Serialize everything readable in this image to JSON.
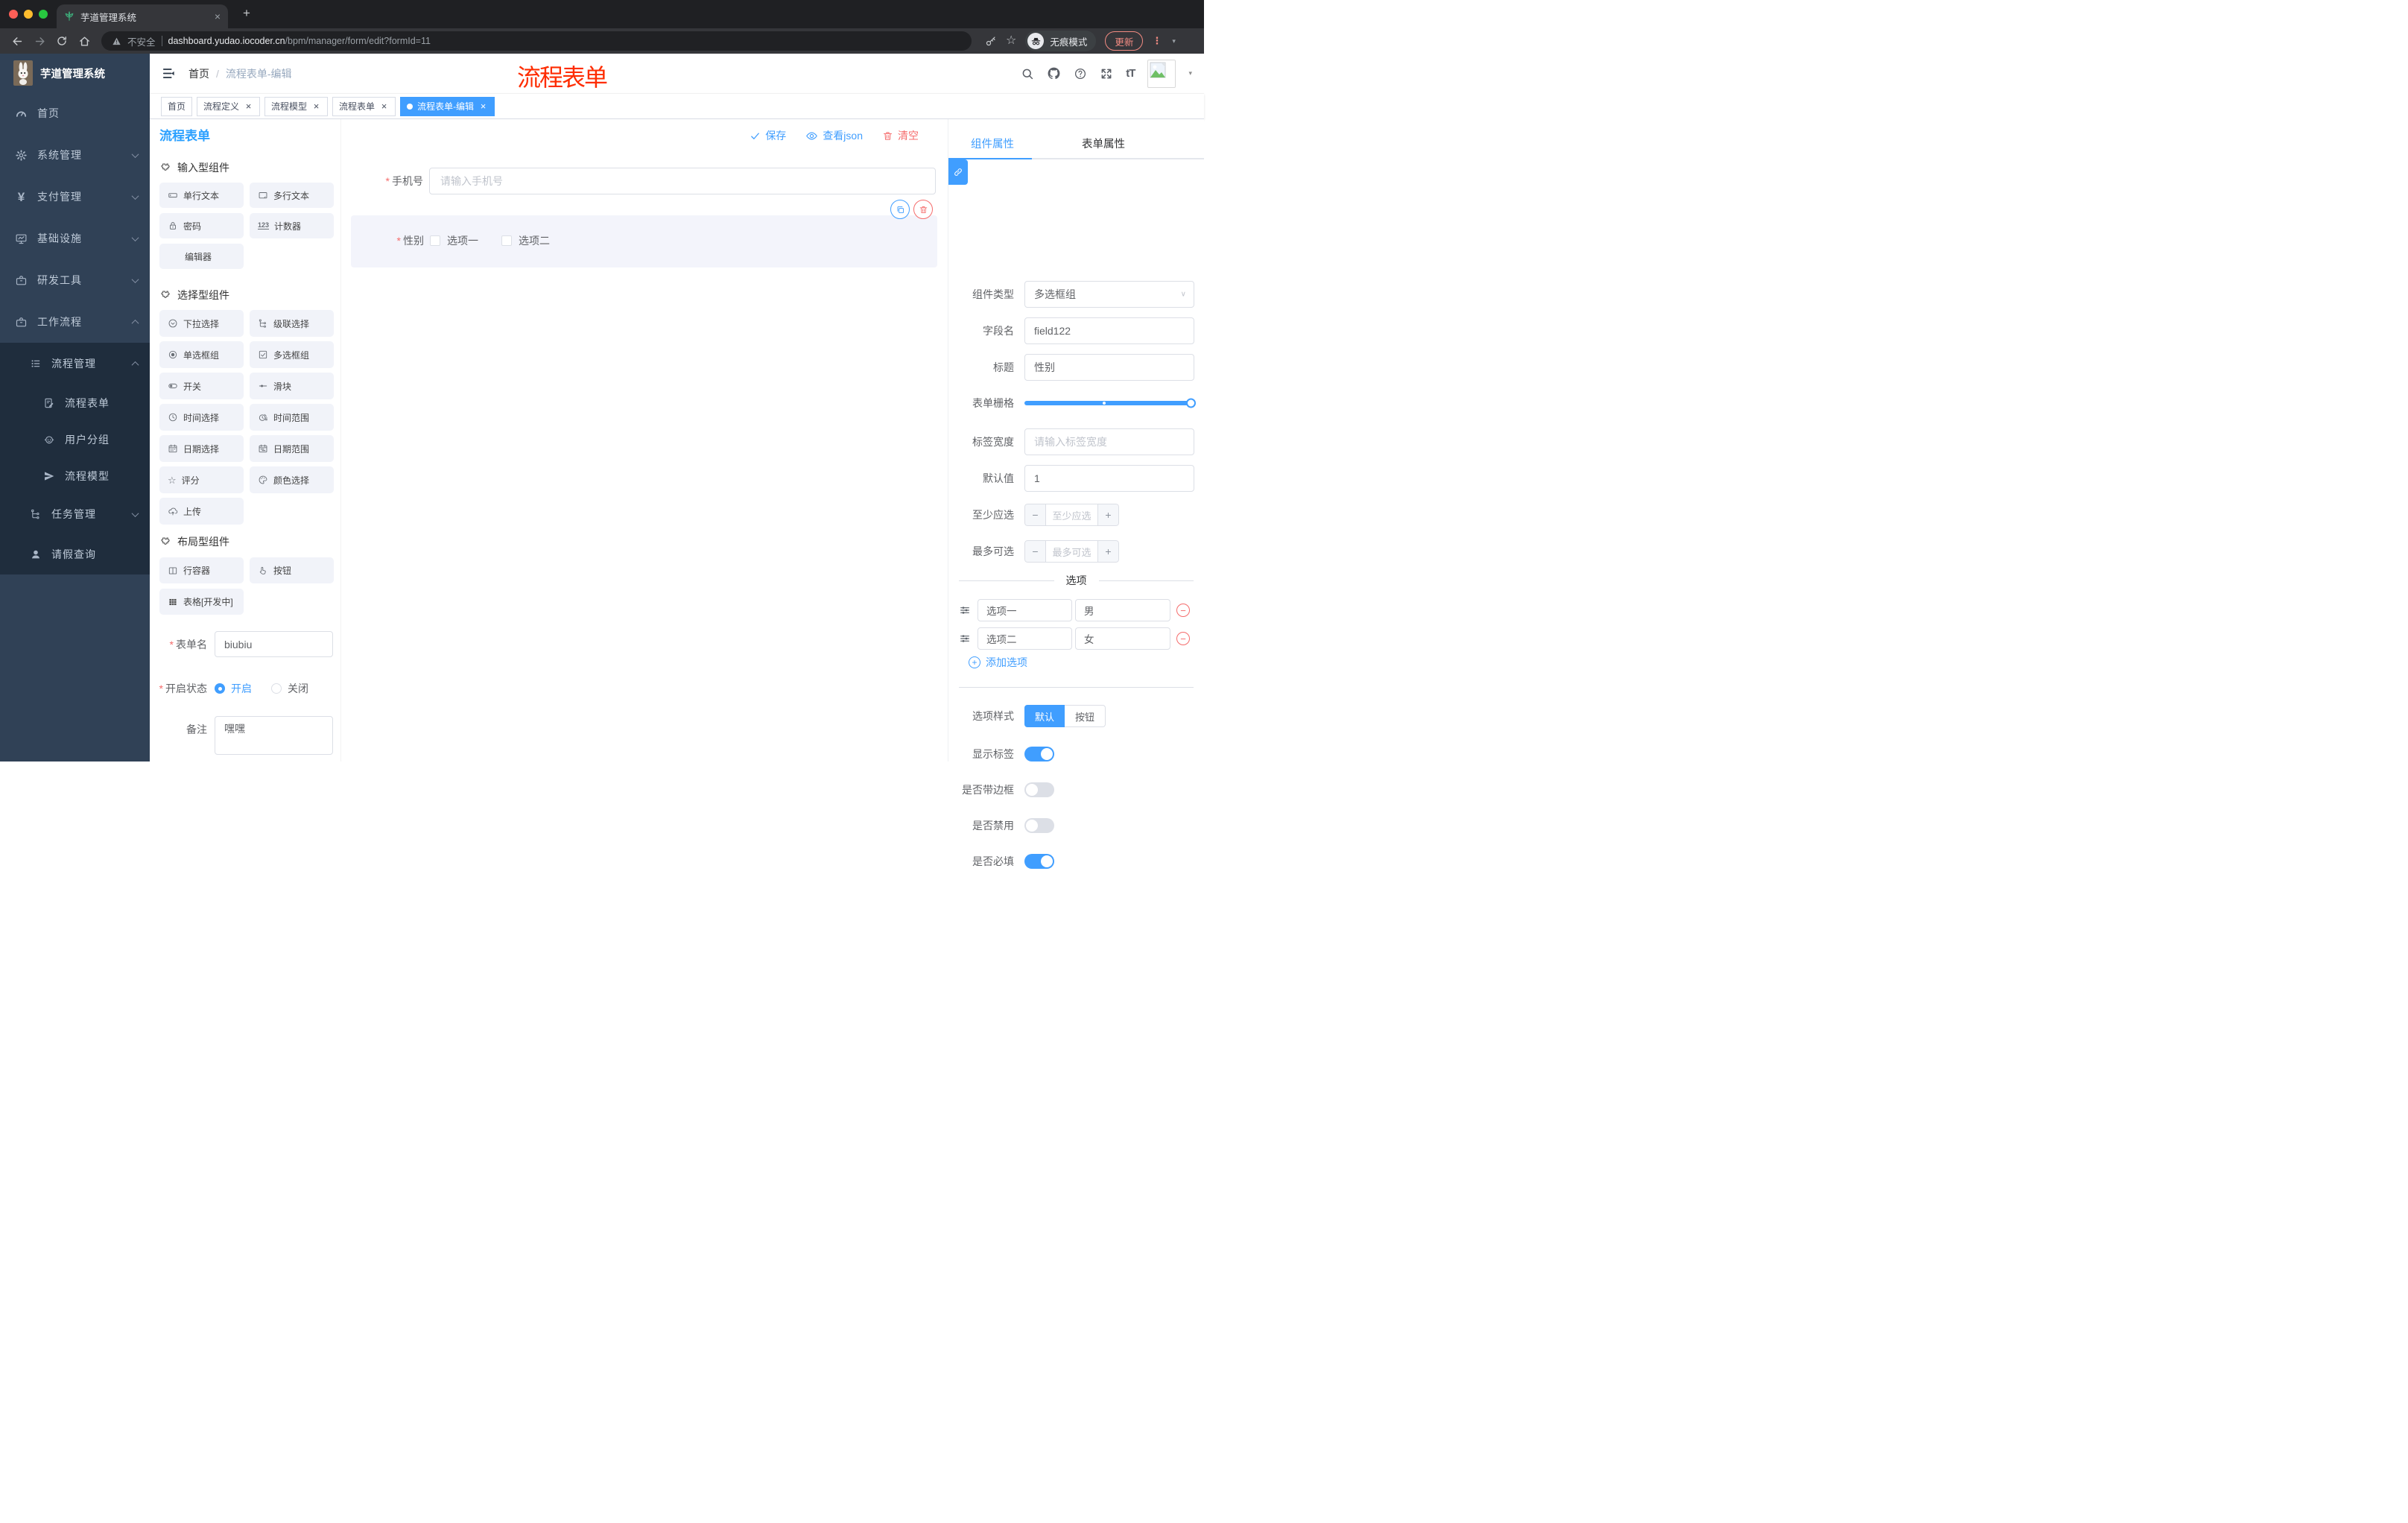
{
  "glyphs": {
    "close": "×",
    "plus": "+",
    "minus": "−",
    "caret_down": "▾",
    "slash": "/",
    "yen": "¥",
    "counter": "123",
    "star": "☆",
    "font_size": "tT",
    "asterisk": "*",
    "dots_v": "⋮"
  },
  "browser": {
    "tab_title": "芋道管理系统",
    "security_label": "不安全",
    "url_host": "dashboard.yudao.iocoder.cn",
    "url_path": "/bpm/manager/form/edit?formId=11",
    "incognito_label": "无痕模式",
    "update_label": "更新"
  },
  "sidebar": {
    "title": "芋道管理系统",
    "items": [
      {
        "label": "首页",
        "icon": "dashboard-icon"
      },
      {
        "label": "系统管理",
        "icon": "gear-icon",
        "chevron": "down"
      },
      {
        "label": "支付管理",
        "icon": "yen-icon",
        "chevron": "down"
      },
      {
        "label": "基础设施",
        "icon": "monitor-icon",
        "chevron": "down"
      },
      {
        "label": "研发工具",
        "icon": "toolbox-icon",
        "chevron": "down"
      },
      {
        "label": "工作流程",
        "icon": "briefcase-icon",
        "chevron": "up"
      },
      {
        "label": "流程管理",
        "icon": "flow-list-icon",
        "chevron": "up"
      },
      {
        "label": "流程表单",
        "icon": "doc-edit-icon"
      },
      {
        "label": "用户分组",
        "icon": "robot-icon"
      },
      {
        "label": "流程模型",
        "icon": "send-icon"
      },
      {
        "label": "任务管理",
        "icon": "tree-icon",
        "chevron": "down"
      },
      {
        "label": "请假查询",
        "icon": "user-icon"
      }
    ]
  },
  "header": {
    "breadcrumb_home": "首页",
    "breadcrumb_current": "流程表单-编辑"
  },
  "annotation": "流程表单",
  "tags": [
    {
      "label": "首页"
    },
    {
      "label": "流程定义"
    },
    {
      "label": "流程模型"
    },
    {
      "label": "流程表单"
    },
    {
      "label": "流程表单-编辑"
    }
  ],
  "page": {
    "title": "流程表单",
    "save_label": "保存",
    "view_json_label": "查看json",
    "clear_label": "清空"
  },
  "components": {
    "sections": [
      {
        "title": "输入型组件",
        "items": [
          {
            "label": "单行文本"
          },
          {
            "label": "多行文本"
          },
          {
            "label": "密码"
          },
          {
            "label": "计数器"
          },
          {
            "label": "编辑器"
          }
        ]
      },
      {
        "title": "选择型组件",
        "items": [
          {
            "label": "下拉选择"
          },
          {
            "label": "级联选择"
          },
          {
            "label": "单选框组"
          },
          {
            "label": "多选框组"
          },
          {
            "label": "开关"
          },
          {
            "label": "滑块"
          },
          {
            "label": "时间选择"
          },
          {
            "label": "时间范围"
          },
          {
            "label": "日期选择"
          },
          {
            "label": "日期范围"
          },
          {
            "label": "评分"
          },
          {
            "label": "颜色选择"
          },
          {
            "label": "上传"
          }
        ]
      },
      {
        "title": "布局型组件",
        "items": [
          {
            "label": "行容器"
          },
          {
            "label": "按钮"
          },
          {
            "label": "表格[开发中]"
          }
        ]
      }
    ],
    "form": {
      "name_label": "表单名",
      "name_value": "biubiu",
      "status_label": "开启状态",
      "status_on": "开启",
      "status_off": "关闭",
      "remark_label": "备注",
      "remark_value": "嘿嘿"
    }
  },
  "canvas": {
    "phone_label": "手机号",
    "phone_placeholder": "请输入手机号",
    "gender_label": "性别",
    "gender_option1": "选项一",
    "gender_option2": "选项二"
  },
  "props": {
    "tab_component": "组件属性",
    "tab_form": "表单属性",
    "type_label": "组件类型",
    "type_value": "多选框组",
    "field_label": "字段名",
    "field_value": "field122",
    "title_label": "标题",
    "title_value": "性别",
    "grid_label": "表单栅格",
    "label_width_label": "标签宽度",
    "label_width_placeholder": "请输入标签宽度",
    "default_label": "默认值",
    "default_value": "1",
    "min_label": "至少应选",
    "min_placeholder": "至少应选",
    "max_label": "最多可选",
    "max_placeholder": "最多可选",
    "options_title": "选项",
    "options": [
      {
        "name": "选项一",
        "value": "男"
      },
      {
        "name": "选项二",
        "value": "女"
      }
    ],
    "add_option_label": "添加选项",
    "style_label": "选项样式",
    "style_default": "默认",
    "style_button": "按钮",
    "show_label_label": "显示标签",
    "border_label": "是否带边框",
    "disabled_label": "是否禁用",
    "required_label": "是否必填"
  },
  "colors": {
    "primary": "#409eff",
    "danger": "#f56c6c",
    "annotation_red": "#fe2c00",
    "sidebar_bg": "#304156",
    "submenu_bg": "#1f2d3d"
  }
}
